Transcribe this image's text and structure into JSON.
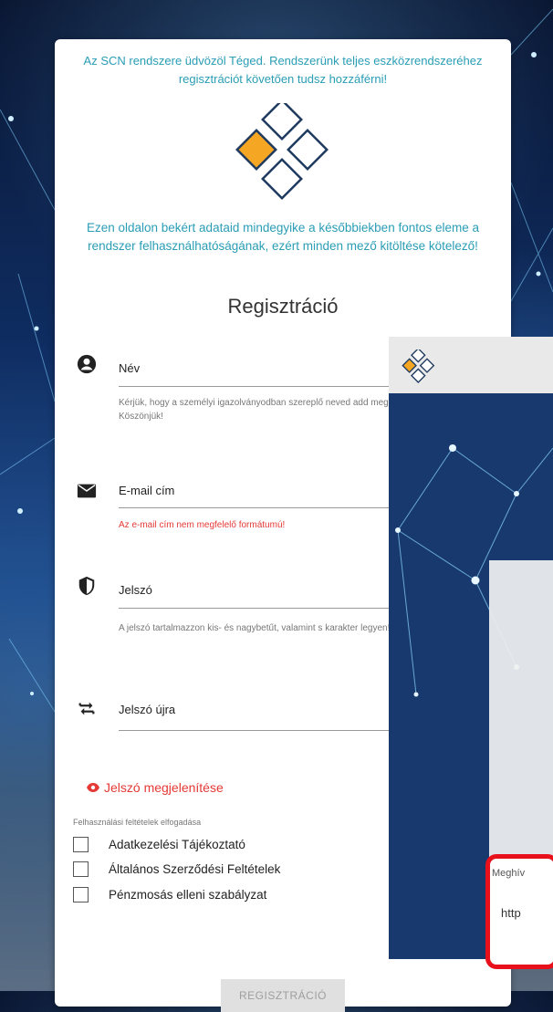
{
  "welcome_text": "Az SCN rendszere üdvözöl Téged. Rendszerünk teljes eszközrendszeréhez regisztrációt követően tudsz hozzáférni!",
  "info_text": "Ezen oldalon bekért adataid mindegyike a későbbiekben fontos eleme a rendszer felhasználhatóságának, ezért minden mező kitöltése kötelező!",
  "title": "Regisztráció",
  "fields": {
    "name": {
      "label": "Név",
      "hint": "Kérjük, hogy a személyi igazolványodban szereplő neved add meg! Köszönjük!",
      "icon": "account-circle-icon"
    },
    "email": {
      "label": "E-mail cím",
      "error": "Az e-mail cím nem megfelelő formátumú!",
      "icon": "envelope-icon"
    },
    "password": {
      "label": "Jelszó",
      "hint": "A jelszó tartalmazzon kis- és nagybetűt, valamint s karakter legyen!",
      "icon": "shield-icon"
    },
    "password_again": {
      "label": "Jelszó újra",
      "icon": "repeat-icon"
    }
  },
  "show_password": "Jelszó megjelenítése",
  "terms": {
    "heading": "Felhasználási feltételek elfogadása",
    "items": [
      "Adatkezelési Tájékoztató",
      "Általános Szerződési Feltételek",
      "Pénzmosás elleni szabályzat"
    ]
  },
  "register_button": "REGISZTRÁCIÓ",
  "overlay": {
    "invite_label": "Meghív",
    "invite_value": "http"
  },
  "colors": {
    "accent": "#2a9db5",
    "error": "#e53935",
    "logo_orange": "#f5a623",
    "logo_navy": "#1f3a5f",
    "highlight": "#e8101a"
  }
}
